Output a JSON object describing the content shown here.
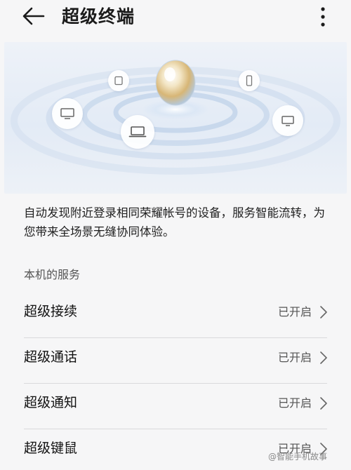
{
  "header": {
    "title": "超级终端"
  },
  "description": "自动发现附近登录相同荣耀帐号的设备，服务智能流转，为您带来全场景无缝协同体验。",
  "section": {
    "title": "本机的服务"
  },
  "services": [
    {
      "label": "超级接续",
      "status": "已开启"
    },
    {
      "label": "超级通话",
      "status": "已开启"
    },
    {
      "label": "超级通知",
      "status": "已开启"
    },
    {
      "label": "超级键鼠",
      "status": "已开启"
    }
  ],
  "watermark": "@智能手机故事",
  "colors": {
    "background": "#f6f6f7",
    "hero_bg": "#e3ebf6",
    "divider": "#d9d9dc"
  }
}
